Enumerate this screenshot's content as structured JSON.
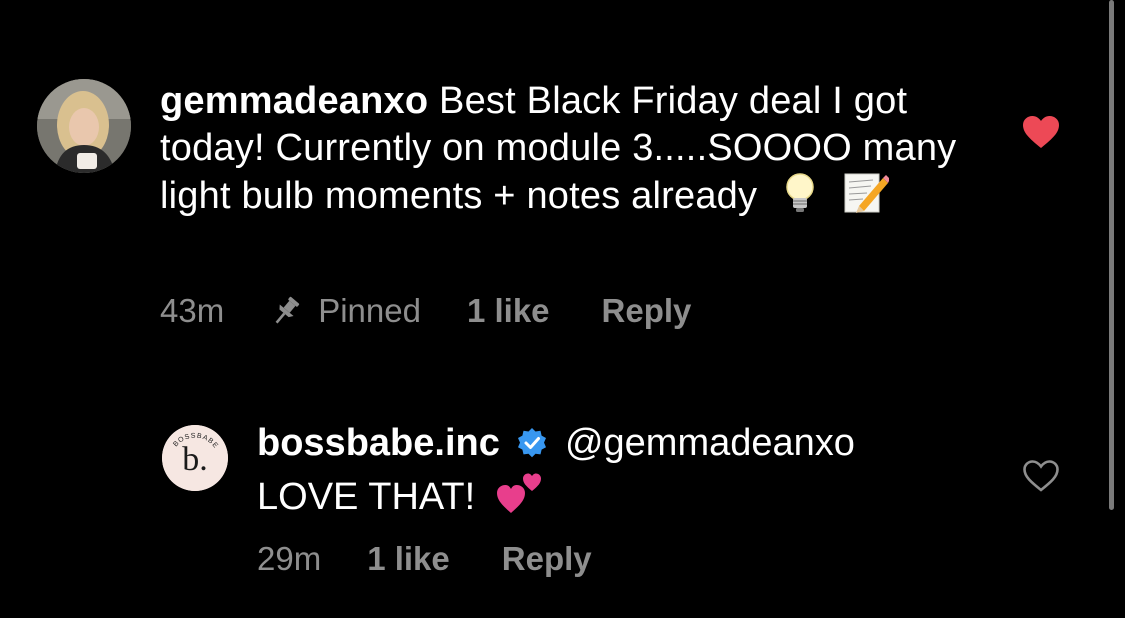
{
  "comments": [
    {
      "username": "gemmadeanxo",
      "text": " Best Black Friday deal I got today! Currently on module 3.....SOOOO many light bulb moments + notes already",
      "emojis": [
        "light-bulb-icon",
        "memo-icon"
      ],
      "time": "43m",
      "pinned_label": "Pinned",
      "likes_label": "1 like",
      "reply_label": "Reply",
      "liked": true
    },
    {
      "username": "bossbabe.inc",
      "verified": true,
      "mention": "@gemmadeanxo",
      "text": "LOVE THAT!",
      "emojis": [
        "two-hearts-icon"
      ],
      "time": "29m",
      "likes_label": "1 like",
      "reply_label": "Reply",
      "liked": false,
      "avatar_logo": "b.",
      "avatar_ring_text": "BOSSBABE"
    }
  ],
  "colors": {
    "background": "#000000",
    "text": "#ffffff",
    "meta": "#8e8e8e",
    "liked_heart": "#ed4956",
    "verified": "#3897f0"
  }
}
